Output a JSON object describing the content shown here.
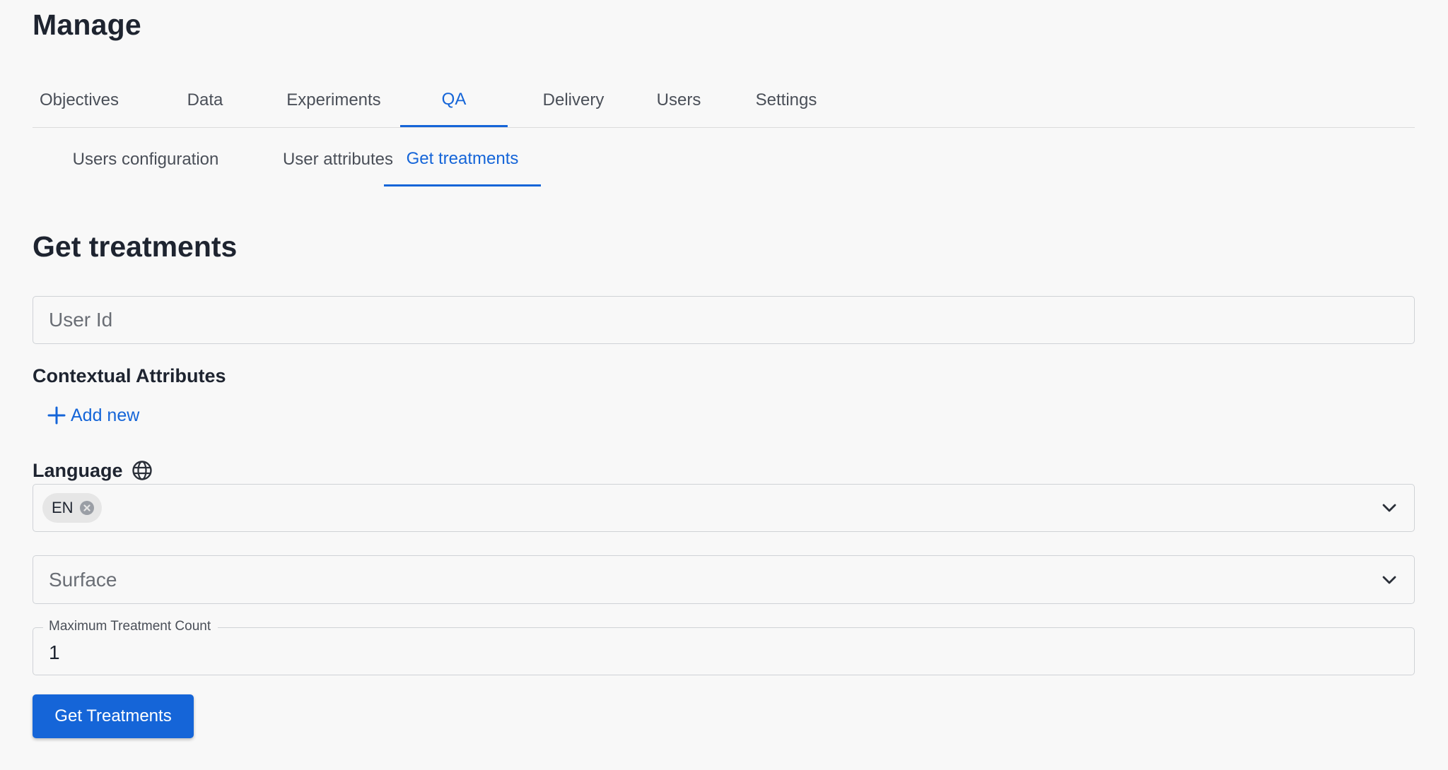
{
  "header": {
    "title": "Manage"
  },
  "primary_tabs": [
    {
      "label": "Objectives",
      "active": false
    },
    {
      "label": "Data",
      "active": false
    },
    {
      "label": "Experiments",
      "active": false
    },
    {
      "label": "QA",
      "active": true
    },
    {
      "label": "Delivery",
      "active": false
    },
    {
      "label": "Users",
      "active": false
    },
    {
      "label": "Settings",
      "active": false
    }
  ],
  "secondary_tabs": [
    {
      "label": "Users configuration",
      "active": false
    },
    {
      "label": "User attributes",
      "active": false
    },
    {
      "label": "Get treatments",
      "active": true
    }
  ],
  "form": {
    "title": "Get treatments",
    "user_id": {
      "placeholder": "User Id",
      "value": ""
    },
    "contextual_attributes": {
      "label": "Contextual Attributes",
      "add_new_label": "Add new",
      "add_icon": "plus-icon"
    },
    "language": {
      "label": "Language",
      "icon": "globe-icon",
      "selected_chips": [
        "EN"
      ],
      "chip_remove_icon": "close-circle-icon",
      "dropdown_icon": "chevron-down-icon"
    },
    "surface": {
      "placeholder": "Surface",
      "dropdown_icon": "chevron-down-icon"
    },
    "max_treatment_count": {
      "label": "Maximum Treatment Count",
      "value": "1"
    },
    "submit_label": "Get Treatments"
  },
  "colors": {
    "accent": "#1565d8",
    "background": "#f8f8f8",
    "text": "#1e2430",
    "muted_text": "#4a4f58",
    "border": "#cfd2d6"
  }
}
